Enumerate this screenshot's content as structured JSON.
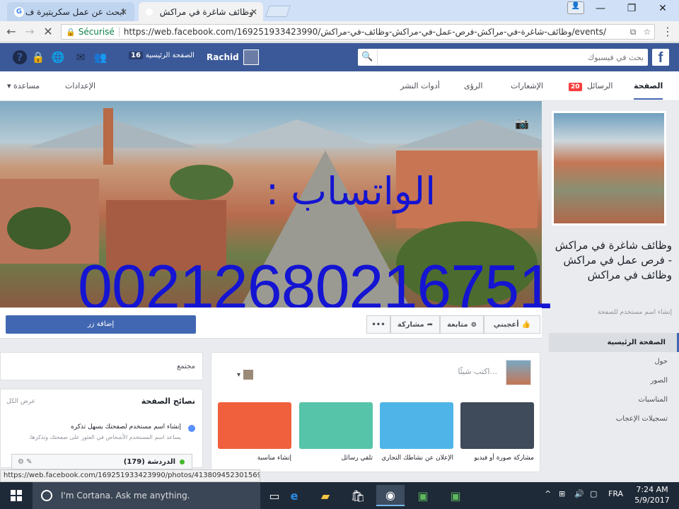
{
  "browser": {
    "tab_inactive_title": "ابحث عن عمل سكريتيرة ف",
    "tab_active_title": "وظائف شاغرة في مراكش",
    "secure_label": "Sécurisé",
    "url": "https://web.facebook.com/169251933423990/وظائف-شاغرة-في-مراكش-فرص-عمل-في-مراكش-وظائف-في-مراكش/events/",
    "status_url": "https://web.facebook.com/169251933423990/photos/413809452301569/"
  },
  "fb": {
    "search_placeholder": "بحث في فيسبوك",
    "profile_name": "Rachid",
    "home_label": "الصفحة الرئيسية",
    "home_count": "16"
  },
  "pagenav": {
    "page": "الصفحة",
    "messages": "الرسائل",
    "messages_count": "20",
    "notifications": "الإشعارات",
    "insights": "الرؤى",
    "publishing_tools": "أدوات النشر",
    "settings": "الإعدادات",
    "help": "مساعدة"
  },
  "cover": {
    "overlay_arabic": "الواتساب :",
    "overlay_number": "00212680216751"
  },
  "page": {
    "name_part1": "وظائف شاغرة في مراكش - فرص عمل في مراكش وظائف في مراكش",
    "username_hint": "إنشاء اسم مستخدم للصفحة",
    "nav": [
      "الصفحة الرئيسية",
      "حول",
      "الصور",
      "المناسبات",
      "تسجيلات الإعجاب"
    ]
  },
  "actions": {
    "add_button": "إضافة زر",
    "like": "أعجبني",
    "follow": "متابعة",
    "share": "مشاركة",
    "more": "•••"
  },
  "composer": {
    "placeholder": "اكتب شيئًا...",
    "cards": [
      {
        "label": "مشاركة صورة أو فيديو",
        "color": "#3f4a5a"
      },
      {
        "label": "الإعلان عن نشاطك التجاري",
        "color": "#4fb5e8"
      },
      {
        "label": "تلقي رسائل",
        "color": "#56c4a8"
      },
      {
        "label": "إنشاء مناسبة",
        "color": "#f0603c"
      }
    ]
  },
  "left": {
    "community": "مجتمع",
    "tips_title": "نصائح الصفحة",
    "see_all": "عرض الكل",
    "tip_line1": "إنشاء اسم مستخدم لصفحتك يسهل تذكره",
    "tip_line2": "يساعد اسم المستخدم الأشخاص في العثور على صفحتك وتذكرها.",
    "chat_label": "الدردشة",
    "chat_count": "(179)"
  },
  "taskbar": {
    "cortana": "I'm Cortana. Ask me anything.",
    "lang": "FRA",
    "time": "7:24 AM",
    "date": "5/9/2017"
  }
}
